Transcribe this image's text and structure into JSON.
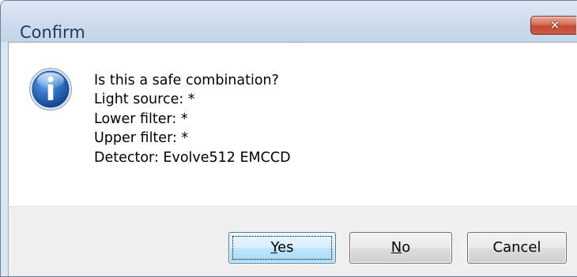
{
  "window": {
    "title": "Confirm"
  },
  "icons": {
    "close": "close-icon",
    "info": "info-icon"
  },
  "message": {
    "lines": [
      "Is this a safe combination?",
      "Light source: *",
      "Lower filter: *",
      "Upper filter: *",
      "Detector: Evolve512 EMCCD"
    ]
  },
  "buttons": {
    "yes": {
      "mnemonic": "Y",
      "rest": "es"
    },
    "no": {
      "mnemonic": "N",
      "rest": "o"
    },
    "cancel": {
      "label": "Cancel"
    }
  },
  "colors": {
    "title_text": "#1e395b",
    "close_button": "#c24a32",
    "info_icon": "#2a64b4",
    "default_button_border": "#3c7fb1"
  }
}
